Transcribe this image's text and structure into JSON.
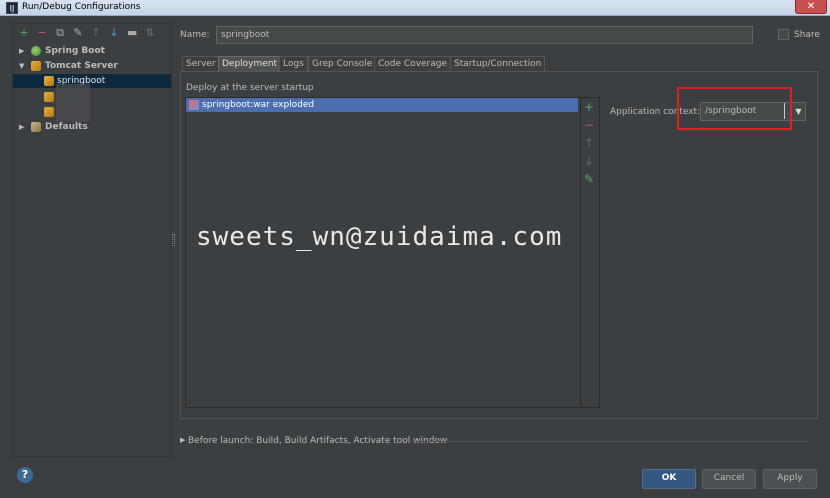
{
  "window": {
    "title": "Run/Debug Configurations",
    "close_glyph": "✕",
    "app_icon": "IJ"
  },
  "toolbar": {
    "icons": [
      {
        "name": "add-icon",
        "glyph": "+",
        "color": "#59a869"
      },
      {
        "name": "remove-icon",
        "glyph": "−",
        "color": "#c75450"
      },
      {
        "name": "copy-icon",
        "glyph": "⧉",
        "color": "#aaaaaa"
      },
      {
        "name": "edit-defaults-icon",
        "glyph": "✎",
        "color": "#aaaaaa"
      },
      {
        "name": "move-up-icon",
        "glyph": "↑",
        "color": "#6a6a6a"
      },
      {
        "name": "move-down-icon",
        "glyph": "↓",
        "color": "#4a9ed6"
      },
      {
        "name": "folder-icon",
        "glyph": "▬",
        "color": "#aaaaaa"
      },
      {
        "name": "sort-icon",
        "glyph": "⇅",
        "color": "#6a6a6a"
      }
    ]
  },
  "tree": {
    "spring_boot": "Spring Boot",
    "tomcat_server": "Tomcat Server",
    "springboot": "springboot",
    "defaults": "Defaults"
  },
  "form": {
    "name_label": "Name:",
    "name_value": "springboot",
    "share_label": "Share"
  },
  "tabs": [
    "Server",
    "Deployment",
    "Logs",
    "Grep Console",
    "Code Coverage",
    "Startup/Connection"
  ],
  "deployment": {
    "heading": "Deploy at the server startup",
    "item": "springboot:war exploded",
    "context_label": "Application context:",
    "context_value": "/springboot"
  },
  "before_launch": "Before launch: Build, Build Artifacts, Activate tool window",
  "watermark": "sweets_wn@zuidaima.com",
  "buttons": {
    "ok": "OK",
    "cancel": "Cancel",
    "apply": "Apply"
  },
  "colors": {
    "accent": "#365880",
    "selection": "#4b6eaf",
    "highlight": "#e02020"
  }
}
